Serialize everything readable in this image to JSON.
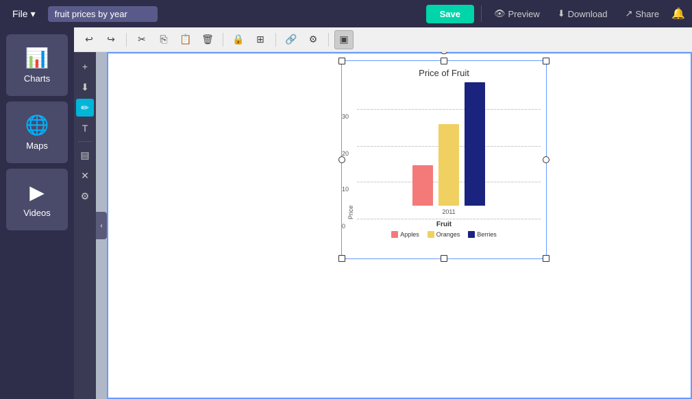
{
  "topbar": {
    "file_label": "File",
    "file_chevron": "▾",
    "doc_title": "fruit prices by year",
    "save_label": "Save",
    "preview_label": "Preview",
    "download_label": "Download",
    "share_label": "Share",
    "preview_icon": "👁",
    "download_icon": "⬇",
    "share_icon": "↗"
  },
  "sidebar": {
    "items": [
      {
        "id": "charts",
        "label": "Charts",
        "icon": "📊"
      },
      {
        "id": "maps",
        "label": "Maps",
        "icon": "🌐"
      },
      {
        "id": "videos",
        "label": "Videos",
        "icon": "▶"
      }
    ]
  },
  "toolbar": {
    "buttons": [
      {
        "id": "undo",
        "symbol": "↩"
      },
      {
        "id": "redo",
        "symbol": "↪"
      },
      {
        "id": "cut",
        "symbol": "✂"
      },
      {
        "id": "copy",
        "symbol": "⎘"
      },
      {
        "id": "paste",
        "symbol": "📋"
      },
      {
        "id": "delete",
        "symbol": "🗑"
      },
      {
        "id": "lock",
        "symbol": "🔒"
      },
      {
        "id": "grid",
        "symbol": "⊞"
      },
      {
        "id": "link",
        "symbol": "🔗"
      },
      {
        "id": "more1",
        "symbol": "⚙"
      },
      {
        "id": "select",
        "symbol": "▣"
      }
    ]
  },
  "tools": {
    "buttons": [
      {
        "id": "add",
        "symbol": "+"
      },
      {
        "id": "download2",
        "symbol": "⬇"
      },
      {
        "id": "pen",
        "symbol": "✏",
        "active": true
      },
      {
        "id": "text",
        "symbol": "T"
      },
      {
        "id": "table",
        "symbol": "▤"
      },
      {
        "id": "close",
        "symbol": "✕"
      },
      {
        "id": "settings",
        "symbol": "⚙"
      }
    ]
  },
  "chart": {
    "title": "Price of Fruit",
    "y_axis_label": "Price",
    "x_axis_label": "Fruit",
    "x_year": "2011",
    "y_ticks": [
      0,
      10,
      20,
      30
    ],
    "bars": [
      {
        "id": "apples",
        "color": "#f47a7a",
        "height_pct": 33,
        "value": 10
      },
      {
        "id": "oranges",
        "color": "#f0d060",
        "height_pct": 66,
        "value": 20
      },
      {
        "id": "berries",
        "color": "#1a237e",
        "height_pct": 100,
        "value": 30
      }
    ],
    "legend": [
      {
        "id": "apples",
        "label": "Apples",
        "color": "#f47a7a"
      },
      {
        "id": "oranges",
        "label": "Oranges",
        "color": "#f0d060"
      },
      {
        "id": "berries",
        "label": "Berries",
        "color": "#1a237e"
      }
    ]
  }
}
